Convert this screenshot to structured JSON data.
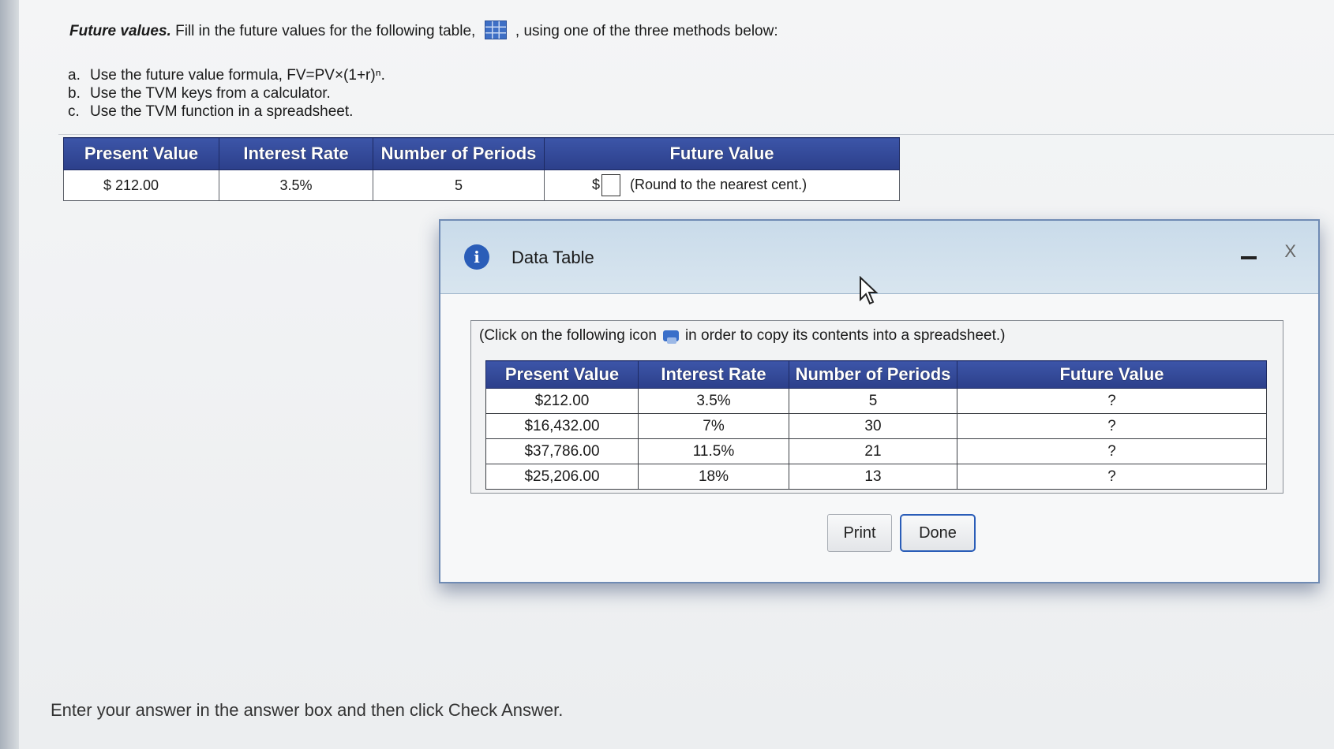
{
  "prompt": {
    "title": "Future values.",
    "text_before": "Fill in the future values for the following table,",
    "text_after": ", using one of the three methods below:"
  },
  "methods": [
    {
      "letter": "a.",
      "text": "Use the future value formula, FV=PV×(1+r)ⁿ."
    },
    {
      "letter": "b.",
      "text": "Use the TVM keys from a calculator."
    },
    {
      "letter": "c.",
      "text": "Use the TVM function in a spreadsheet."
    }
  ],
  "main_table": {
    "headers": [
      "Present Value",
      "Interest Rate",
      "Number of Periods",
      "Future Value"
    ],
    "row": {
      "present_value": "$   212.00",
      "interest_rate": "3.5%",
      "periods": "5",
      "currency": "$",
      "future_value_input": "",
      "round_note": "(Round to the nearest cent.)"
    }
  },
  "dialog": {
    "title": "Data Table",
    "close_label": "X",
    "copy_note_before": "(Click on the following icon",
    "copy_note_after": "in order to copy its contents into a spreadsheet.)",
    "headers": [
      "Present Value",
      "Interest Rate",
      "Number of Periods",
      "Future Value"
    ],
    "rows": [
      [
        "$212.00",
        "3.5%",
        "5",
        "?"
      ],
      [
        "$16,432.00",
        "7%",
        "30",
        "?"
      ],
      [
        "$37,786.00",
        "11.5%",
        "21",
        "?"
      ],
      [
        "$25,206.00",
        "18%",
        "13",
        "?"
      ]
    ],
    "print_label": "Print",
    "done_label": "Done"
  },
  "footer": "Enter your answer in the answer box and then click Check Answer."
}
